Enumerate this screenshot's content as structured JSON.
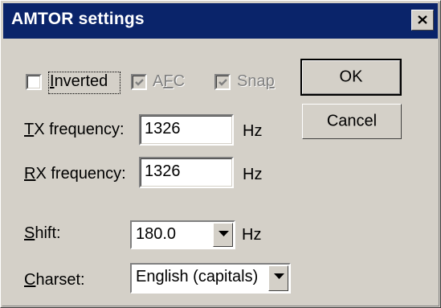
{
  "window": {
    "title": "AMTOR settings",
    "close_icon": "close-icon"
  },
  "checkboxes": {
    "inverted": {
      "label_u": "I",
      "label_rest": "nverted",
      "checked": false,
      "enabled": true
    },
    "afc": {
      "label_pre": "A",
      "label_u": "F",
      "label_rest": "C",
      "checked": true,
      "enabled": false
    },
    "snap": {
      "label_pre": "Sna",
      "label_u": "p",
      "label_rest": "",
      "checked": true,
      "enabled": false
    }
  },
  "tx": {
    "label_u": "T",
    "label_rest": "X frequency:",
    "value": "1326",
    "unit": "Hz"
  },
  "rx": {
    "label_u": "R",
    "label_rest": "X frequency:",
    "value": "1326",
    "unit": "Hz"
  },
  "shift": {
    "label_u": "S",
    "label_rest": "hift:",
    "value": "180.0",
    "unit": "Hz"
  },
  "charset": {
    "label_u": "C",
    "label_rest": "harset:",
    "value": "English (capitals)"
  },
  "buttons": {
    "ok": "OK",
    "cancel": "Cancel"
  }
}
